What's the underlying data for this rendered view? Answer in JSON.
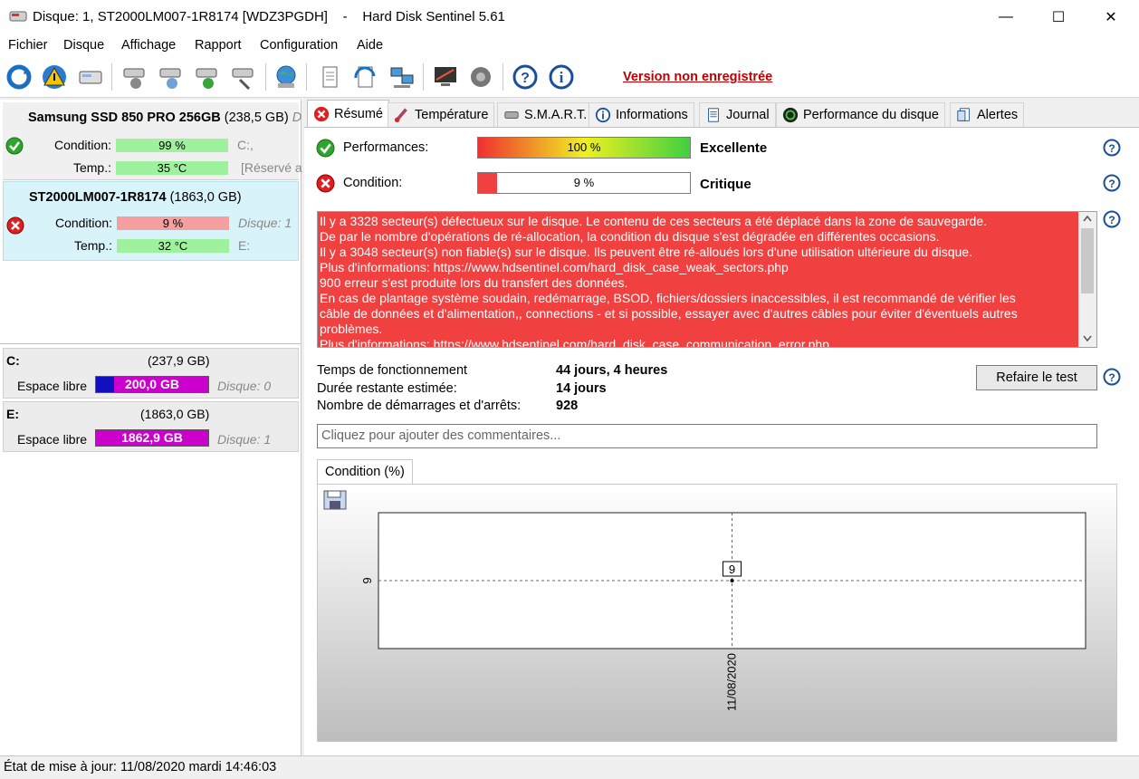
{
  "window": {
    "title": "Disque: 1, ST2000LM007-1R8174 [WDZ3PGDH]    -    Hard Disk Sentinel 5.61",
    "minimize": "—",
    "maximize": "☐",
    "close": "✕"
  },
  "menu": [
    "Fichier",
    "Disque",
    "Affichage",
    "Rapport",
    "Configuration",
    "Aide"
  ],
  "toolbar": {
    "unregistered": "Version non enregistrée"
  },
  "disks": [
    {
      "name": "Samsung SSD 850 PRO 256GB",
      "size": "(238,5 GB)",
      "extra": "D",
      "condition_label": "Condition:",
      "condition_value": "99 %",
      "condition_pct": 99,
      "condition_side": "C:,",
      "temp_label": "Temp.:",
      "temp_value": "35 °C",
      "temp_side": "[Réservé a",
      "status": "ok"
    },
    {
      "name": "ST2000LM007-1R8174",
      "size": "(1863,0 GB)",
      "condition_label": "Condition:",
      "condition_value": "9 %",
      "condition_pct": 9,
      "condition_side": "Disque: 1",
      "temp_label": "Temp.:",
      "temp_value": "32 °C",
      "temp_side": "E:",
      "status": "critical"
    }
  ],
  "volumes": [
    {
      "letter": "C:",
      "size": "(237,9 GB)",
      "free_label": "Espace libre",
      "free_value": "200,0 GB",
      "disk": "Disque: 0"
    },
    {
      "letter": "E:",
      "size": "(1863,0 GB)",
      "free_label": "Espace libre",
      "free_value": "1862,9 GB",
      "disk": "Disque: 1"
    }
  ],
  "tabs": [
    "Résumé",
    "Température",
    "S.M.A.R.T.",
    "Informations",
    "Journal",
    "Performance du disque",
    "Alertes"
  ],
  "summary": {
    "performance_label": "Performances:",
    "performance_value": "100 %",
    "performance_pct": 100,
    "performance_verdict": "Excellente",
    "condition_label": "Condition:",
    "condition_value": "9 %",
    "condition_pct": 9,
    "condition_verdict": "Critique",
    "messages": [
      "Il y a 3328 secteur(s) défectueux sur le disque. Le contenu de ces secteurs a été déplacé dans la zone de sauvegarde.",
      "De par le nombre d'opérations de ré-allocation, la condition du disque s'est dégradée en différentes occasions.",
      "Il y a 3048 secteur(s) non fiable(s) sur le disque. Ils peuvent être ré-alloués lors d'une utilisation ultérieure du disque.",
      "Plus d'informations: https://www.hdsentinel.com/hard_disk_case_weak_sectors.php",
      "900 erreur s'est produite lors du transfert des données.",
      "En cas de plantage système soudain, redémarrage, BSOD, fichiers/dossiers inaccessibles, il est recommandé de vérifier les",
      "câble de données et d'alimentation,, connections - et si possible, essayer avec d'autres câbles pour éviter d'éventuels autres",
      "problèmes.",
      "Plus d'informations: https://www.hdsentinel.com/hard_disk_case_communication_error.php"
    ],
    "uptime_label": "Temps de fonctionnement",
    "uptime_value": "44 jours, 4 heures",
    "remaining_label": "Durée restante estimée:",
    "remaining_value": "14 jours",
    "startstop_label": "Nombre de démarrages et d'arrêts:",
    "startstop_value": "928",
    "retest_button": "Refaire le test",
    "comment_placeholder": "Cliquez pour ajouter des commentaires..."
  },
  "chart_tab": "Condition (%)",
  "chart_data": {
    "type": "line",
    "x": [
      "11/08/2020"
    ],
    "series": [
      {
        "values": [
          9
        ]
      }
    ],
    "ytick_labels": [
      "9"
    ],
    "xtick_labels": [
      "11/08/2020"
    ],
    "data_labels": [
      "9"
    ],
    "grid": true
  },
  "statusbar": {
    "text": "État de mise à jour: 11/08/2020 mardi 14:46:03"
  },
  "colors": {
    "good": "#9ef29e",
    "bad": "#f4a0a0",
    "critical_panel": "#f04040",
    "free_space": "#cc00cc",
    "link": "#c00000"
  }
}
